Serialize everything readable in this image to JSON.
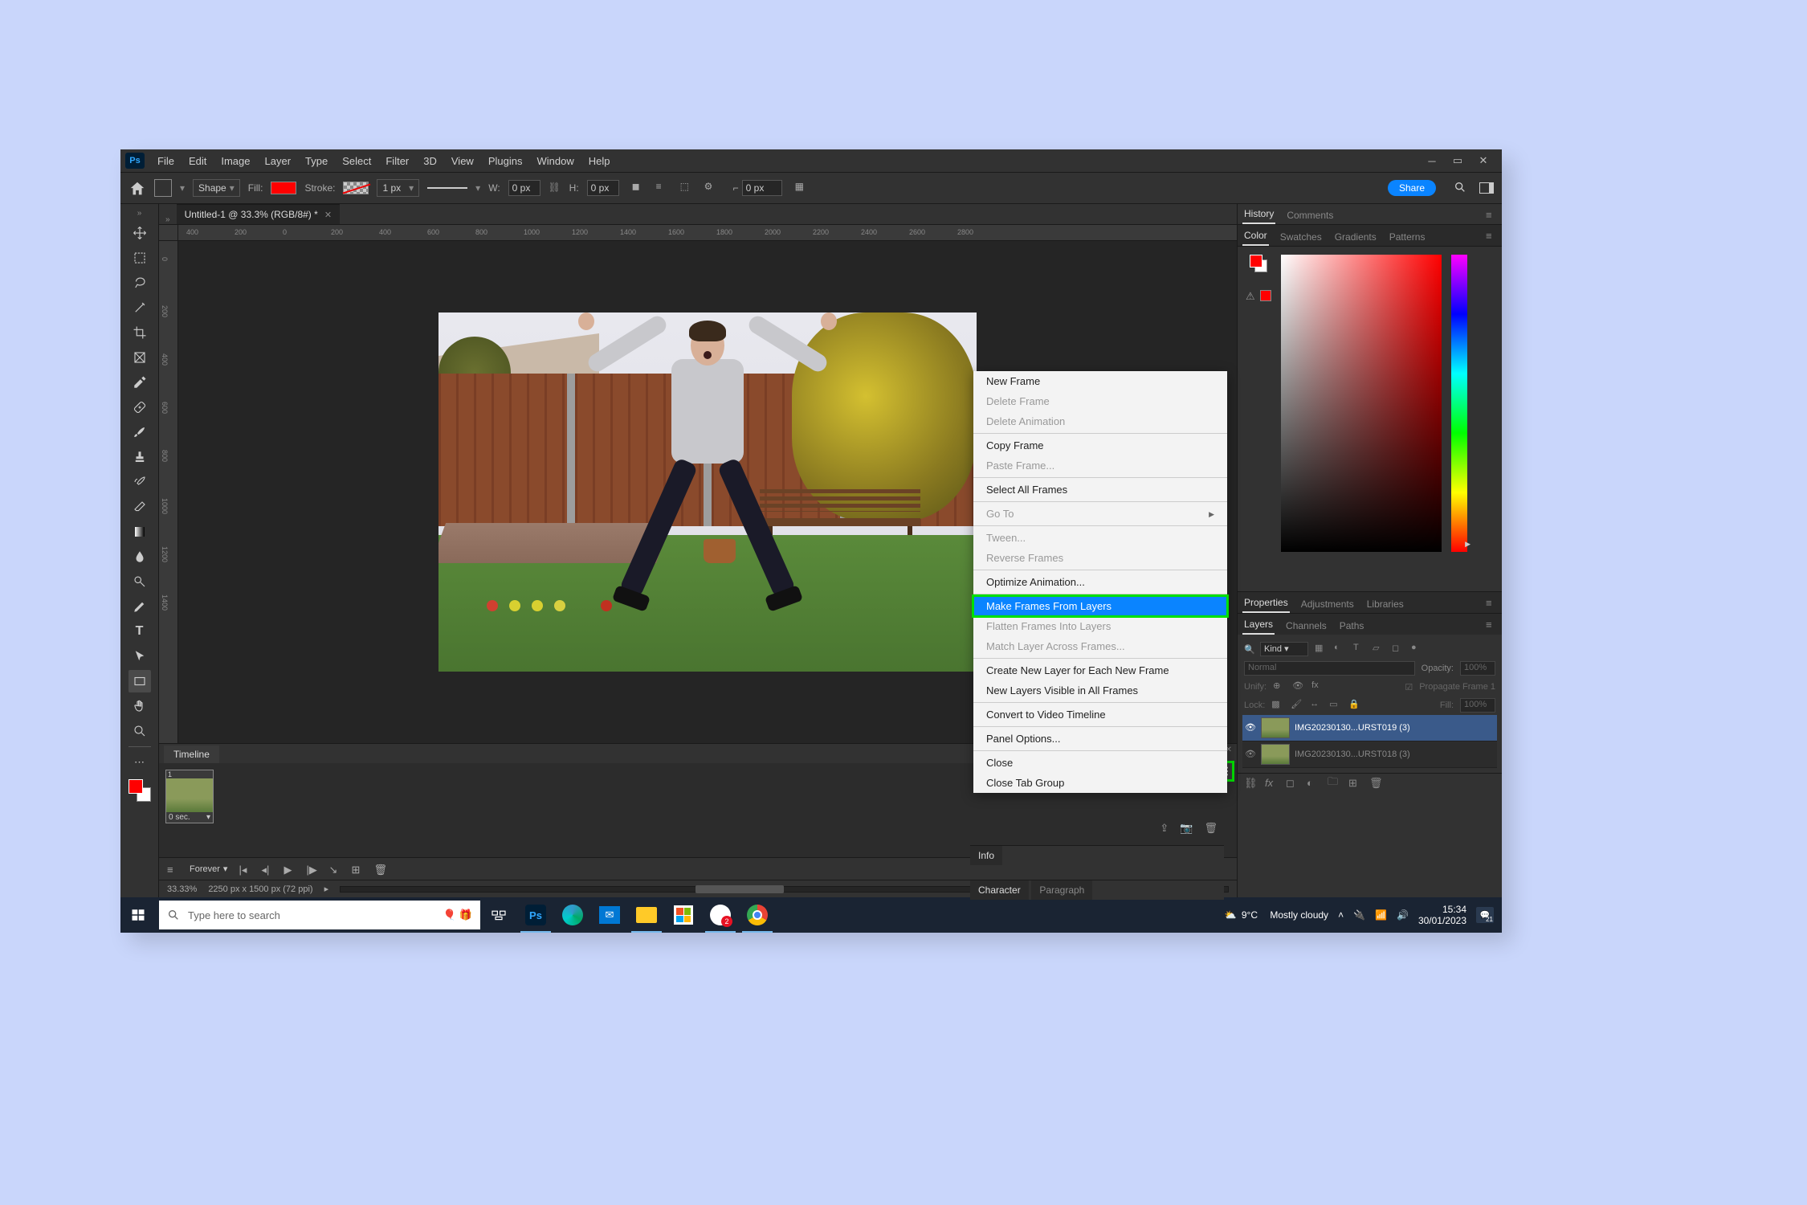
{
  "menubar": {
    "items": [
      "File",
      "Edit",
      "Image",
      "Layer",
      "Type",
      "Select",
      "Filter",
      "3D",
      "View",
      "Plugins",
      "Window",
      "Help"
    ]
  },
  "optionsbar": {
    "shape_mode": "Shape",
    "fill_label": "Fill:",
    "stroke_label": "Stroke:",
    "stroke_width": "1 px",
    "w_label": "W:",
    "w_val": "0 px",
    "h_label": "H:",
    "h_val": "0 px",
    "radius": "0 px",
    "share": "Share"
  },
  "doc": {
    "tab_title": "Untitled-1 @ 33.3% (RGB/8#) *"
  },
  "ruler_h": [
    "400",
    "200",
    "0",
    "200",
    "400",
    "600",
    "800",
    "1000",
    "1200",
    "1400",
    "1600",
    "1800",
    "2000",
    "2200",
    "2400",
    "2600",
    "2800"
  ],
  "ruler_v": [
    "0",
    "200",
    "400",
    "600",
    "800",
    "1000",
    "1200",
    "1400"
  ],
  "timeline": {
    "tab": "Timeline",
    "frame_number": "1",
    "frame_duration": "0 sec.",
    "loop": "Forever"
  },
  "status": {
    "zoom": "33.33%",
    "dims": "2250 px x 1500 px (72 ppi)"
  },
  "context_menu": {
    "items": [
      {
        "label": "New Frame"
      },
      {
        "label": "Delete Frame",
        "disabled": true
      },
      {
        "label": "Delete Animation",
        "disabled": true
      },
      {
        "sep": true
      },
      {
        "label": "Copy Frame"
      },
      {
        "label": "Paste Frame...",
        "disabled": true
      },
      {
        "sep": true
      },
      {
        "label": "Select All Frames"
      },
      {
        "sep": true
      },
      {
        "label": "Go To",
        "arrow": true,
        "disabled": true
      },
      {
        "sep": true
      },
      {
        "label": "Tween...",
        "disabled": true
      },
      {
        "label": "Reverse Frames",
        "disabled": true
      },
      {
        "sep": true
      },
      {
        "label": "Optimize Animation..."
      },
      {
        "sep": true
      },
      {
        "label": "Make Frames From Layers",
        "highlight": true
      },
      {
        "label": "Flatten Frames Into Layers",
        "disabled": true
      },
      {
        "label": "Match Layer Across Frames...",
        "disabled": true
      },
      {
        "sep": true
      },
      {
        "label": "Create New Layer for Each New Frame"
      },
      {
        "label": "New Layers Visible in All Frames"
      },
      {
        "sep": true
      },
      {
        "label": "Convert to Video Timeline"
      },
      {
        "sep": true
      },
      {
        "label": "Panel Options..."
      },
      {
        "sep": true
      },
      {
        "label": "Close"
      },
      {
        "label": "Close Tab Group"
      }
    ]
  },
  "panels": {
    "history_tabs": [
      "History",
      "Comments"
    ],
    "color_tabs": [
      "Color",
      "Swatches",
      "Gradients",
      "Patterns"
    ],
    "prop_tabs": [
      "Properties",
      "Adjustments",
      "Libraries"
    ],
    "layer_tabs": [
      "Layers",
      "Channels",
      "Paths"
    ],
    "info_tab": "Info",
    "char_tabs": [
      "Character",
      "Paragraph"
    ]
  },
  "layers": {
    "kind": "Kind",
    "blend": "Normal",
    "opacity_label": "Opacity:",
    "opacity_val": "100%",
    "unify": "Unify:",
    "propagate": "Propagate Frame 1",
    "lock": "Lock:",
    "fill_label": "Fill:",
    "fill_val": "100%",
    "items": [
      "IMG20230130...URST019 (3)",
      "IMG20230130...URST018 (3)"
    ]
  },
  "taskbar": {
    "search_placeholder": "Type here to search",
    "temp": "9°C",
    "weather": "Mostly cloudy",
    "time": "15:34",
    "date": "30/01/2023",
    "notif": "21"
  }
}
